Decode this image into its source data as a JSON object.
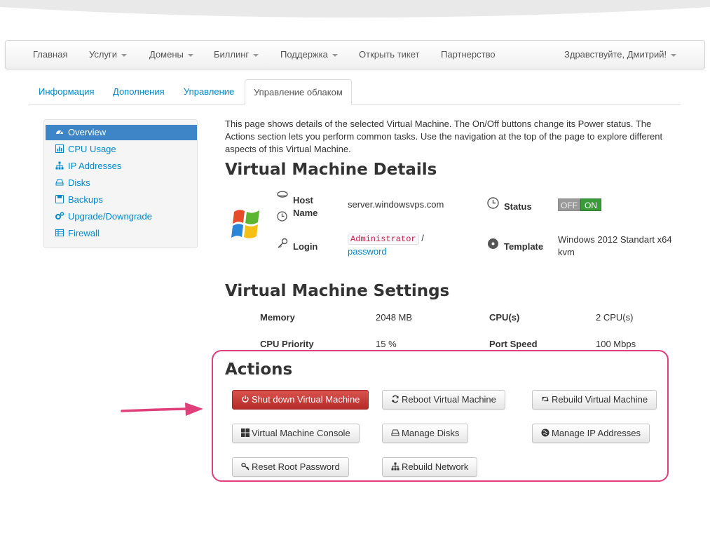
{
  "nav": {
    "items": [
      {
        "label": "Главная",
        "dropdown": false
      },
      {
        "label": "Услуги",
        "dropdown": true
      },
      {
        "label": "Домены",
        "dropdown": true
      },
      {
        "label": "Биллинг",
        "dropdown": true
      },
      {
        "label": "Поддержка",
        "dropdown": true
      },
      {
        "label": "Открыть тикет",
        "dropdown": false
      },
      {
        "label": "Партнерство",
        "dropdown": false
      }
    ],
    "greeting": "Здравствуйте, Дмитрий!"
  },
  "tabs": [
    "Информация",
    "Дополнения",
    "Управление",
    "Управление облаком"
  ],
  "sidebar": {
    "items": [
      {
        "label": "Overview",
        "icon": "dashboard-icon",
        "active": true
      },
      {
        "label": "CPU Usage",
        "icon": "bar-chart-icon",
        "active": false
      },
      {
        "label": "IP Addresses",
        "icon": "sitemap-icon",
        "active": false
      },
      {
        "label": "Disks",
        "icon": "hdd-icon",
        "active": false
      },
      {
        "label": "Backups",
        "icon": "save-icon",
        "active": false
      },
      {
        "label": "Upgrade/Downgrade",
        "icon": "cogs-icon",
        "active": false
      },
      {
        "label": "Firewall",
        "icon": "table-icon",
        "active": false
      }
    ]
  },
  "intro": "This page shows details of the selected Virtual Machine. The On/Off buttons change its Power status. The Actions section lets you perform common tasks. Use the navigation at the top of the page to explore different aspects of this Virtual Machine.",
  "details": {
    "title": "Virtual Machine Details",
    "hostname_label": "Host Name",
    "hostname_value": "server.windowsvps.com",
    "status_label": "Status",
    "status_off": "OFF",
    "status_on": "ON",
    "login_label": "Login",
    "login_user": "Administrator",
    "login_sep": "/",
    "login_password": "password",
    "template_label": "Template",
    "template_value": "Windows 2012 Standart x64 kvm"
  },
  "settings": {
    "title": "Virtual Machine Settings",
    "memory_label": "Memory",
    "memory_value": "2048 MB",
    "cpus_label": "CPU(s)",
    "cpus_value": "2 CPU(s)",
    "cpu_priority_label": "CPU Priority",
    "cpu_priority_value": "15 %",
    "port_speed_label": "Port Speed",
    "port_speed_value": "100 Mbps"
  },
  "actions": {
    "title": "Actions",
    "shutdown": "Shut down Virtual Machine",
    "reboot": "Reboot Virtual Machine",
    "rebuild_vm": "Rebuild Virtual Machine",
    "console": "Virtual Machine Console",
    "manage_disks": "Manage Disks",
    "manage_ip": "Manage IP Addresses",
    "reset_password": "Reset Root Password",
    "rebuild_network": "Rebuild Network"
  },
  "colors": {
    "link": "#0088cc",
    "active_sidebar": "#3d85c6",
    "danger": "#d9534f",
    "highlight": "#e0407a",
    "on_green": "#3a9a3a"
  }
}
